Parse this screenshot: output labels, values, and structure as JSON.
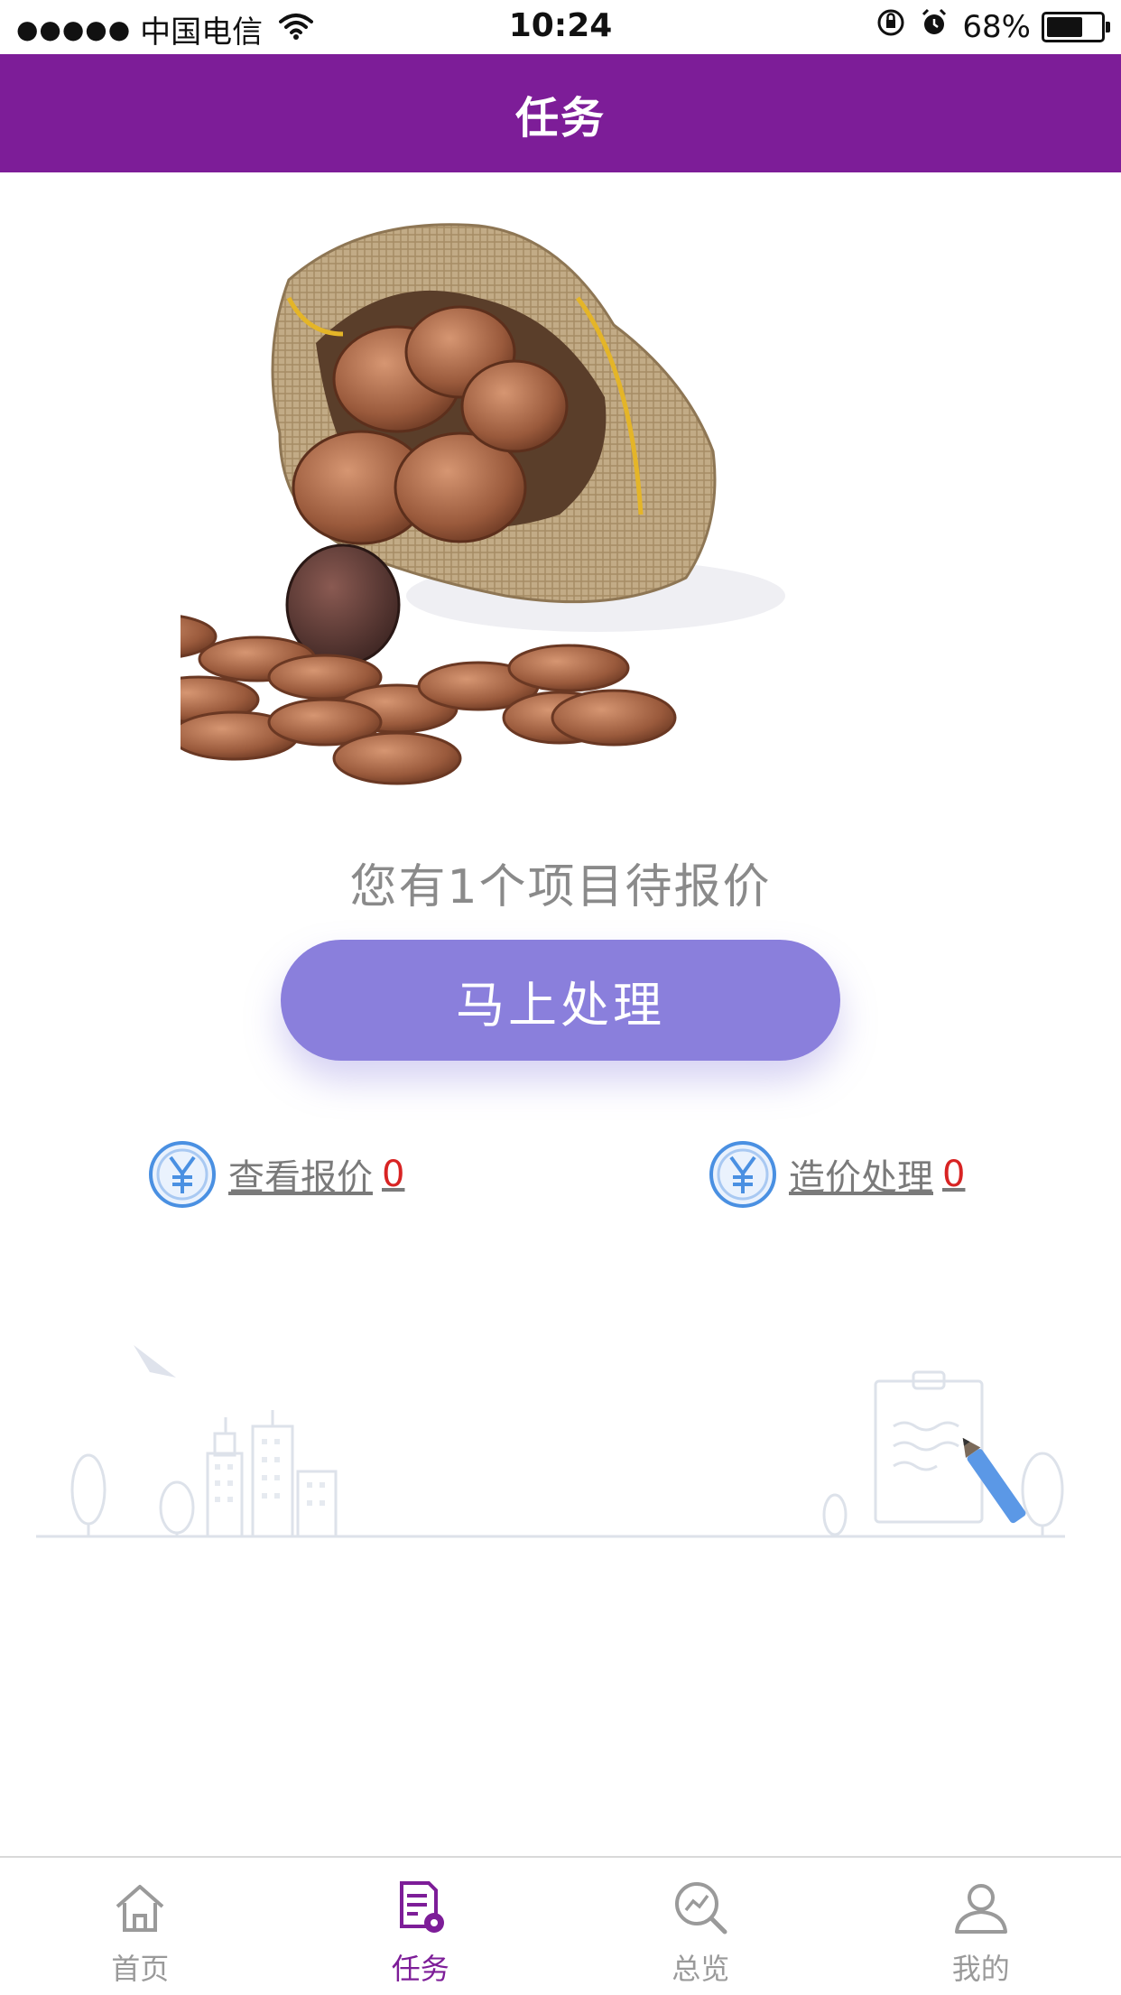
{
  "status_bar": {
    "signal": "●●●●●",
    "carrier": "中国电信",
    "time": "10:24",
    "battery_text": "68%",
    "battery_level": 0.68
  },
  "header": {
    "title": "任务"
  },
  "main": {
    "pending_message": "您有1个项目待报价",
    "process_button_label": "马上处理",
    "links": [
      {
        "label": "查看报价",
        "count": "0"
      },
      {
        "label": "造价处理",
        "count": "0"
      }
    ]
  },
  "tab_bar": {
    "items": [
      {
        "label": "首页",
        "icon": "home-icon",
        "active": false
      },
      {
        "label": "任务",
        "icon": "task-icon",
        "active": true
      },
      {
        "label": "总览",
        "icon": "overview-icon",
        "active": false
      },
      {
        "label": "我的",
        "icon": "profile-icon",
        "active": false
      }
    ]
  },
  "colors": {
    "brand_purple": "#7d1d98",
    "button_purple": "#8a7fdc",
    "count_red": "#d82323",
    "yen_blue": "#4a90e2"
  }
}
